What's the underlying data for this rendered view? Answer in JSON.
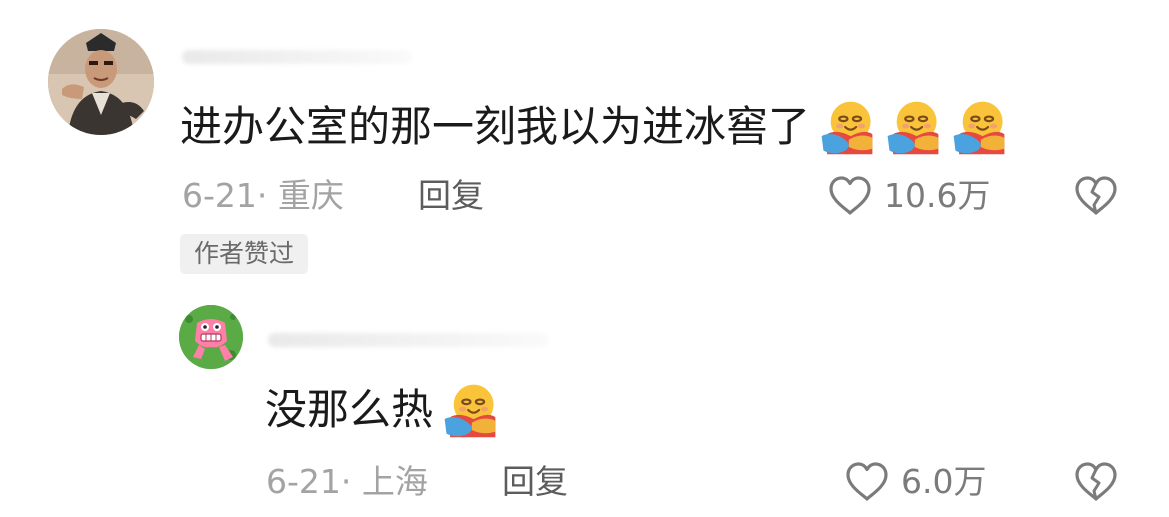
{
  "comments": [
    {
      "avatar_icon": "user-avatar-photo",
      "text": "进办公室的那一刻我以为进冰窖了",
      "emoji_icon": "smiling-face-with-hearts-hug-emoji",
      "emoji_count": 3,
      "date_location": "6-21· 重庆",
      "reply_label": "回复",
      "like_count": "10.6万",
      "badge": "作者赞过"
    },
    {
      "avatar_icon": "cartoon-monster-avatar",
      "text": "没那么热",
      "emoji_icon": "smiling-face-with-hearts-hug-emoji",
      "emoji_count": 1,
      "date_location": "6-21· 上海",
      "reply_label": "回复",
      "like_count": "6.0万"
    }
  ],
  "icons": {
    "like": "heart-outline-icon",
    "dislike": "broken-heart-icon"
  },
  "colors": {
    "text_primary": "#1a1a1a",
    "text_secondary": "#a3a3a3",
    "reply_text": "#5c5c5c",
    "badge_bg": "#f0f0f0"
  }
}
